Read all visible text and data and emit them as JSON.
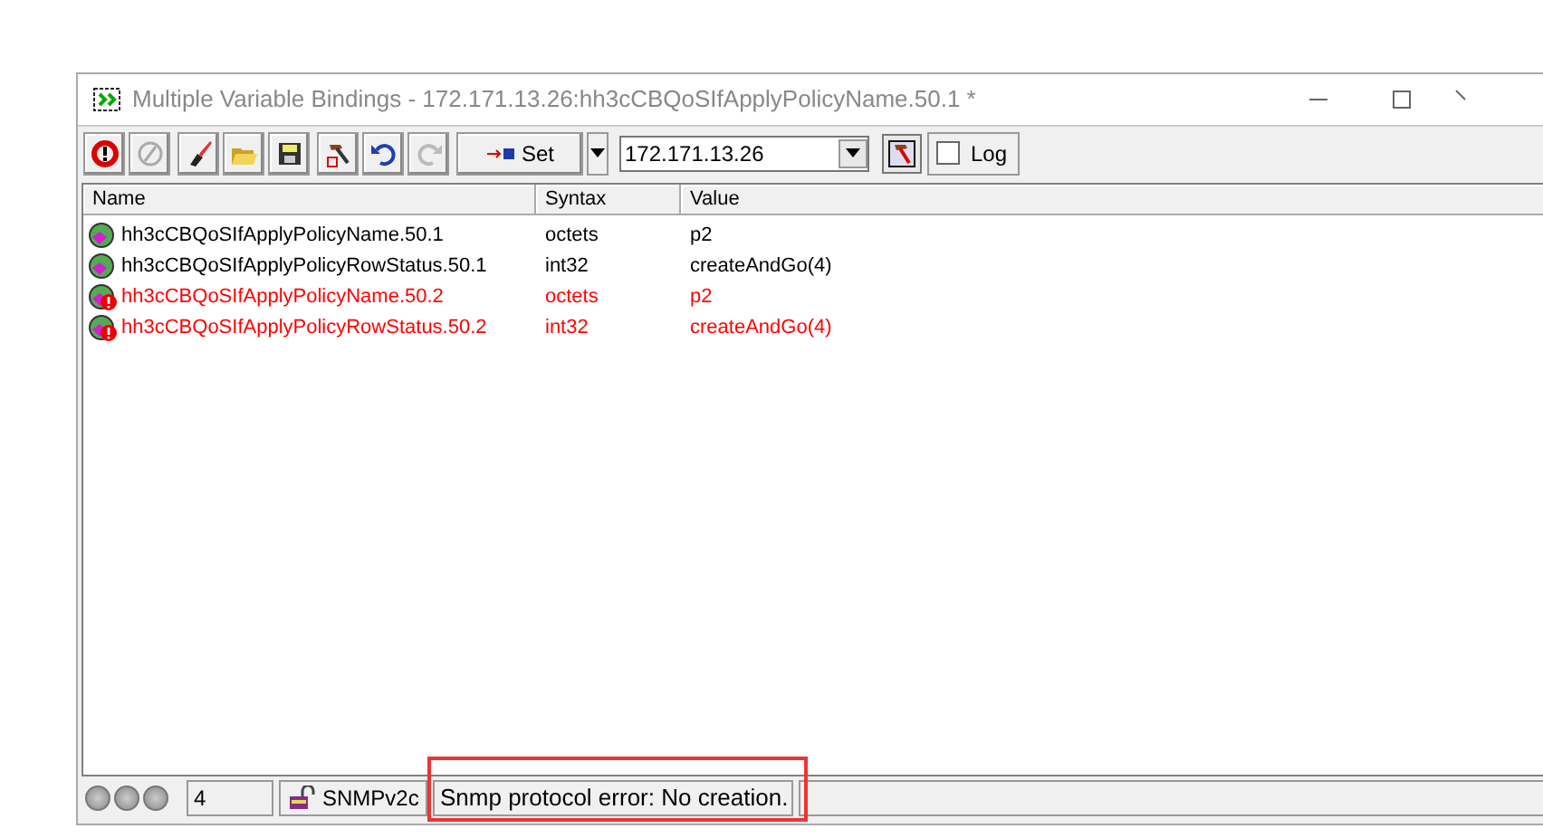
{
  "window": {
    "title": "Multiple Variable Bindings - 172.171.13.26:hh3cCBQoSIfApplyPolicyName.50.1 *"
  },
  "toolbar": {
    "set_button": "Set",
    "agent_address": "172.171.13.26",
    "log": {
      "label": "Log",
      "checked": false
    }
  },
  "table": {
    "columns": [
      "Name",
      "Syntax",
      "Value"
    ],
    "rows": [
      {
        "name": "hh3cCBQoSIfApplyPolicyName.50.1",
        "syntax": "octets",
        "value": "p2",
        "error": false
      },
      {
        "name": "hh3cCBQoSIfApplyPolicyRowStatus.50.1",
        "syntax": "int32",
        "value": "createAndGo(4)",
        "error": false
      },
      {
        "name": "hh3cCBQoSIfApplyPolicyName.50.2",
        "syntax": "octets",
        "value": "p2",
        "error": true
      },
      {
        "name": "hh3cCBQoSIfApplyPolicyRowStatus.50.2",
        "syntax": "int32",
        "value": "createAndGo(4)",
        "error": true
      }
    ]
  },
  "status_bar": {
    "count": "4",
    "version": "SNMPv2c",
    "message": "Snmp protocol error: No creation."
  }
}
